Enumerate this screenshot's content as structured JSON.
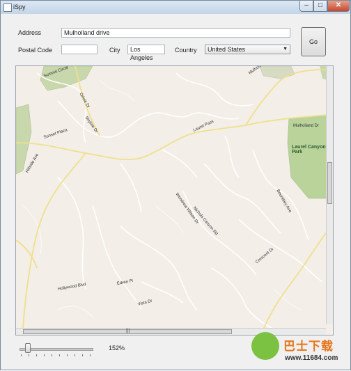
{
  "window": {
    "title": "iSpy",
    "minimize_glyph": "–",
    "maximize_glyph": "□",
    "close_glyph": "✕"
  },
  "form": {
    "address_label": "Address",
    "address_value": "Mulholland drive",
    "postal_label": "Postal Code",
    "postal_value": "",
    "city_label": "City",
    "city_value": "Los Angeles",
    "country_label": "Country",
    "country_value": "United States",
    "go_label": "Go"
  },
  "map": {
    "streets": [
      "Summit Circle",
      "Mulholland Dr",
      "Mulholland Dr",
      "Oriole Dr",
      "Skyline Dr",
      "Sunset Plaza",
      "Hillside Ave",
      "Laurel Pass",
      "Woodrow Wilson Dr",
      "Nichols Canyon Rd",
      "Crescent Dr",
      "Edwin Pl",
      "Hollywood Blvd",
      "Boundary Ave",
      "Vista Dr"
    ],
    "park": "Laurel Canyon Park"
  },
  "zoom": {
    "value": "152%"
  },
  "watermark": {
    "text": "巴士下载",
    "url": "www.11684.com"
  }
}
